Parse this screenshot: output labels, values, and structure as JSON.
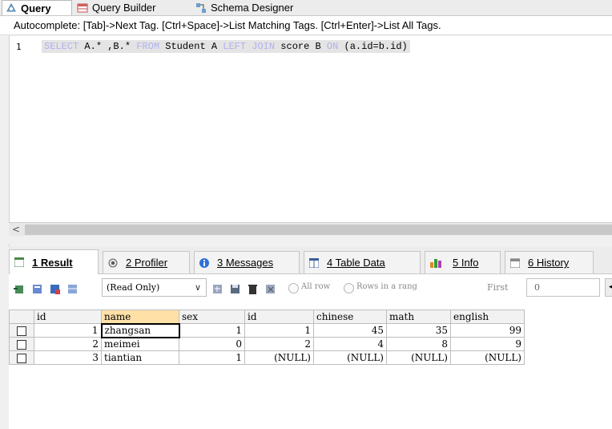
{
  "top_tabs": [
    {
      "label": "Query",
      "icon": "query-icon",
      "active": true
    },
    {
      "label": "Query Builder",
      "icon": "query-builder-icon",
      "active": false
    },
    {
      "label": "Schema Designer",
      "icon": "schema-designer-icon",
      "active": false
    }
  ],
  "autocomplete_hint": "Autocomplete: [Tab]->Next Tag. [Ctrl+Space]->List Matching Tags. [Ctrl+Enter]->List All Tags.",
  "editor": {
    "line_number": "1",
    "sql": {
      "kw_select": "SELECT",
      "part1": " A.* ,B.* ",
      "kw_from": "FROM",
      "part2": " Student A ",
      "kw_left": "LEFT",
      "space": " ",
      "kw_join": "JOIN",
      "part3": " score B ",
      "kw_on": "ON",
      "part4": " (a.id=b.id)"
    }
  },
  "scroll_left_arrow": "<",
  "result_tabs": [
    {
      "label": "1 Result",
      "active": true
    },
    {
      "label": "2 Profiler",
      "active": false
    },
    {
      "label": "3 Messages",
      "active": false
    },
    {
      "label": "4 Table Data",
      "active": false
    },
    {
      "label": "5 Info",
      "active": false
    },
    {
      "label": "6 History",
      "active": false
    }
  ],
  "toolbar": {
    "mode_select": "(Read Only)",
    "radio_all_rows": "All row",
    "radio_rows_range": "Rows in a rang",
    "first_label": "First",
    "first_value": "0"
  },
  "grid": {
    "columns": [
      "id",
      "name",
      "sex",
      "id",
      "chinese",
      "math",
      "english"
    ],
    "rows": [
      [
        "1",
        "zhangsan",
        "1",
        "1",
        "45",
        "35",
        "99"
      ],
      [
        "2",
        "meimei",
        "0",
        "2",
        "4",
        "8",
        "9"
      ],
      [
        "3",
        "tiantian",
        "1",
        "(NULL)",
        "(NULL)",
        "(NULL)",
        "(NULL)"
      ]
    ]
  },
  "colors": {
    "keyword": "#b0b0f0",
    "selected_header": "#ffe1a8"
  }
}
